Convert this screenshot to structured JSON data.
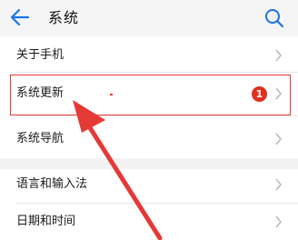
{
  "header": {
    "title": "系统",
    "back_icon": "back-arrow-icon",
    "search_icon": "search-icon"
  },
  "rows": [
    {
      "label": "关于手机"
    },
    {
      "label": "系统更新",
      "badge": "1",
      "highlighted": true
    },
    {
      "label": "系统导航"
    },
    {
      "label": "语言和输入法"
    },
    {
      "label": "日期和时间"
    }
  ],
  "colors": {
    "accent": "#1a73e8",
    "badge": "#e0301e",
    "annotation": "#e53935",
    "header_bg": "#f5f5f5",
    "section_gap": "#f2f2f2"
  }
}
